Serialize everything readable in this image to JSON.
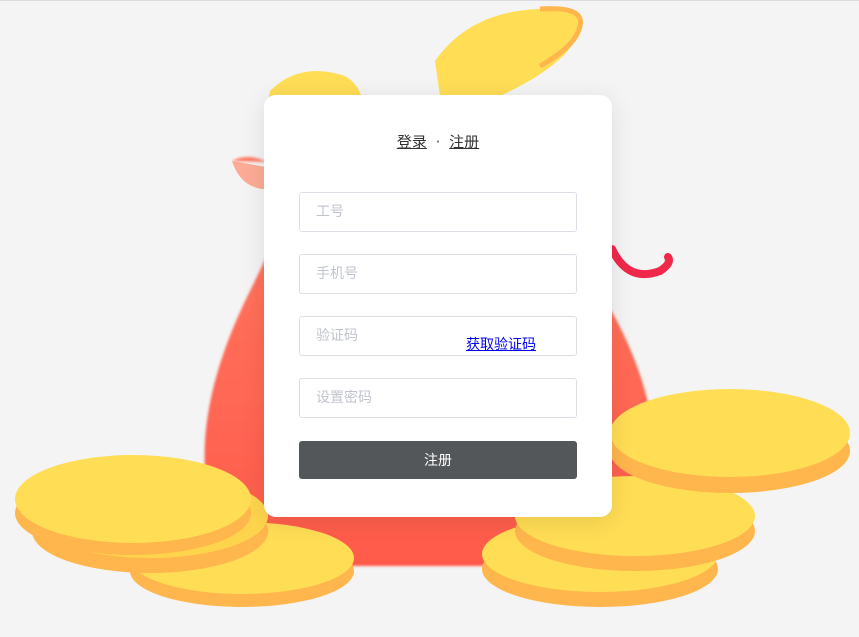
{
  "tabs": {
    "login": "登录",
    "separator": "·",
    "register": "注册"
  },
  "form": {
    "employee_id": {
      "placeholder": "工号",
      "value": ""
    },
    "phone": {
      "placeholder": "手机号",
      "value": ""
    },
    "code": {
      "placeholder": "验证码",
      "value": "",
      "get_code_label": "获取验证码"
    },
    "password": {
      "placeholder": "设置密码",
      "value": ""
    },
    "submit_label": "注册"
  },
  "colors": {
    "background": "#f4f4f4",
    "bag": "#ff6a5a",
    "coin_top": "#ffdd55",
    "coin_side": "#ffb64d",
    "accent_red": "#f0284a",
    "button": "#54575a"
  }
}
